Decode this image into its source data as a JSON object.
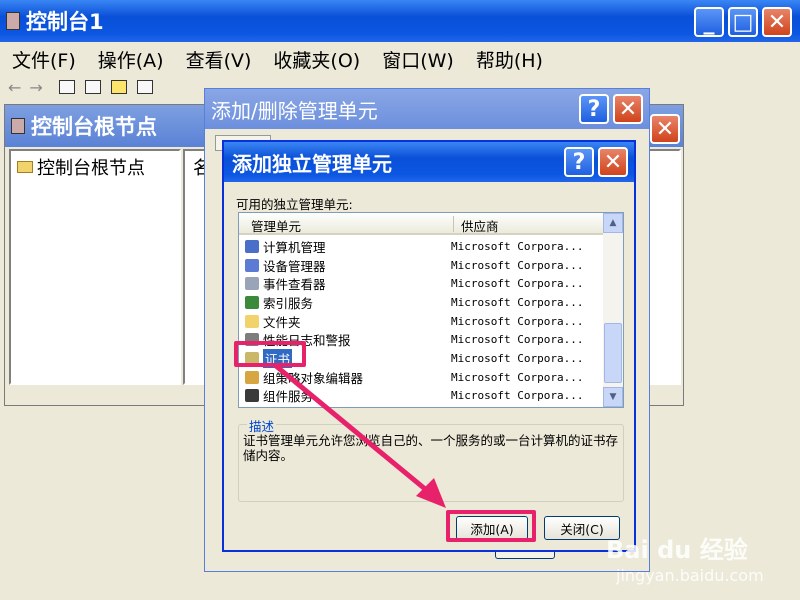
{
  "main_window": {
    "title": "控制台1",
    "menu": [
      "文件(F)",
      "操作(A)",
      "查看(V)",
      "收藏夹(O)",
      "窗口(W)",
      "帮助(H)"
    ],
    "min_glyph": "_",
    "max_glyph": "□",
    "close_glyph": "✕"
  },
  "child_window": {
    "title": "控制台根节点",
    "tree_item": "控制台根节点",
    "col_frag": "名"
  },
  "dialog_back": {
    "title": "添加/删除管理单元",
    "help_glyph": "?",
    "close_glyph": "✕"
  },
  "dialog": {
    "title": "添加独立管理单元",
    "help_glyph": "?",
    "close_glyph": "✕",
    "available_label": "可用的独立管理单元:",
    "columns": {
      "name": "管理单元",
      "vendor": "供应商"
    },
    "items": [
      {
        "name": "计算机管理",
        "vendor": "Microsoft Corpora...",
        "icon": "computer-management-icon",
        "color": "#4a6fc9"
      },
      {
        "name": "设备管理器",
        "vendor": "Microsoft Corpora...",
        "icon": "device-manager-icon",
        "color": "#5b7bd4"
      },
      {
        "name": "事件查看器",
        "vendor": "Microsoft Corpora...",
        "icon": "event-viewer-icon",
        "color": "#9aa4b8"
      },
      {
        "name": "索引服务",
        "vendor": "Microsoft Corpora...",
        "icon": "indexing-service-icon",
        "color": "#3b8a3b"
      },
      {
        "name": "文件夹",
        "vendor": "Microsoft Corpora...",
        "icon": "folder-icon",
        "color": "#f2d36b"
      },
      {
        "name": "性能日志和警报",
        "vendor": "Microsoft Corpora...",
        "icon": "performance-logs-icon",
        "color": "#7d7d7d"
      },
      {
        "name": "证书",
        "vendor": "Microsoft Corpora...",
        "icon": "certificate-icon",
        "color": "#c9b76a",
        "selected": true
      },
      {
        "name": "组策略对象编辑器",
        "vendor": "Microsoft Corpora...",
        "icon": "group-policy-icon",
        "color": "#d8a640"
      },
      {
        "name": "组件服务",
        "vendor": "Microsoft Corpora...",
        "icon": "component-services-icon",
        "color": "#3a3a3a"
      }
    ],
    "description_title": "描述",
    "description": "证书管理单元允许您浏览自己的、一个服务的或一台计算机的证书存储内容。",
    "add_button": "添加(A)",
    "close_button": "关闭(C)",
    "scroll_up": "▲",
    "scroll_down": "▼"
  },
  "watermark": {
    "logo": "Bai du 经验",
    "url": "jingyan.baidu.com"
  },
  "colors": {
    "xp_blue": "#0a50d8",
    "highlight": "#e8226a"
  }
}
